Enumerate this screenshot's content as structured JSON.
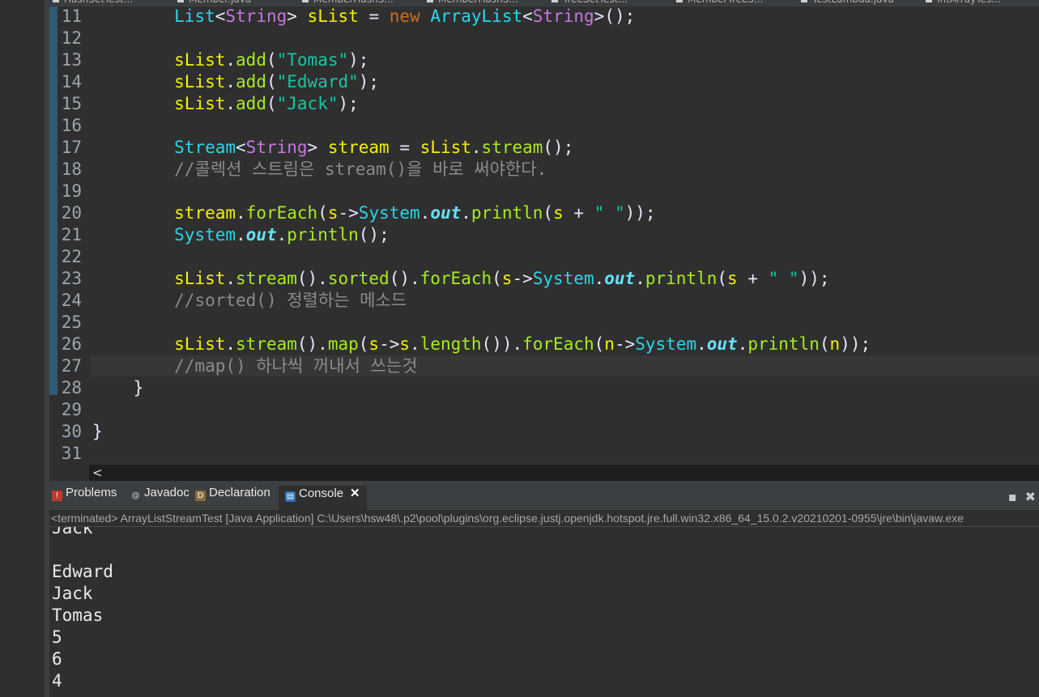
{
  "editor_tabs": [
    "HashSetTest...",
    "Member.java",
    "MemberHashS...",
    "MemberHashS...",
    "TreeSetTest...",
    "MemberTreeS...",
    "TestLambda.java",
    "IntArrayTes..."
  ],
  "code_lines": [
    {
      "n": "11",
      "tokens": [
        [
          "        ",
          ""
        ],
        [
          "List",
          "ty"
        ],
        [
          "<",
          "op"
        ],
        [
          "String",
          "tp"
        ],
        [
          ">",
          "op"
        ],
        [
          " ",
          ""
        ],
        [
          "sList",
          "id"
        ],
        [
          " ",
          ""
        ],
        [
          "=",
          "op"
        ],
        [
          " ",
          ""
        ],
        [
          "new",
          "kw"
        ],
        [
          " ",
          ""
        ],
        [
          "ArrayList",
          "ty"
        ],
        [
          "<",
          "op"
        ],
        [
          "String",
          "tp"
        ],
        [
          ">",
          "op"
        ],
        [
          "();",
          "op"
        ]
      ]
    },
    {
      "n": "12",
      "tokens": []
    },
    {
      "n": "13",
      "tokens": [
        [
          "        ",
          ""
        ],
        [
          "sList",
          "id"
        ],
        [
          ".",
          "op"
        ],
        [
          "add",
          "me"
        ],
        [
          "(",
          "op"
        ],
        [
          "\"Tomas\"",
          "str"
        ],
        [
          ");",
          "op"
        ]
      ]
    },
    {
      "n": "14",
      "tokens": [
        [
          "        ",
          ""
        ],
        [
          "sList",
          "id"
        ],
        [
          ".",
          "op"
        ],
        [
          "add",
          "me"
        ],
        [
          "(",
          "op"
        ],
        [
          "\"Edward\"",
          "str"
        ],
        [
          ");",
          "op"
        ]
      ]
    },
    {
      "n": "15",
      "tokens": [
        [
          "        ",
          ""
        ],
        [
          "sList",
          "id"
        ],
        [
          ".",
          "op"
        ],
        [
          "add",
          "me"
        ],
        [
          "(",
          "op"
        ],
        [
          "\"Jack\"",
          "str"
        ],
        [
          ");",
          "op"
        ]
      ]
    },
    {
      "n": "16",
      "tokens": []
    },
    {
      "n": "17",
      "tokens": [
        [
          "        ",
          ""
        ],
        [
          "Stream",
          "ty"
        ],
        [
          "<",
          "op"
        ],
        [
          "String",
          "tp"
        ],
        [
          ">",
          "op"
        ],
        [
          " ",
          ""
        ],
        [
          "stream",
          "id"
        ],
        [
          " ",
          ""
        ],
        [
          "=",
          "op"
        ],
        [
          " ",
          ""
        ],
        [
          "sList",
          "id"
        ],
        [
          ".",
          "op"
        ],
        [
          "stream",
          "me"
        ],
        [
          "();",
          "op"
        ]
      ]
    },
    {
      "n": "18",
      "tokens": [
        [
          "        ",
          ""
        ],
        [
          "//콜렉션 스트림은 stream()을 바로 써야한다.",
          "cm"
        ]
      ]
    },
    {
      "n": "19",
      "tokens": []
    },
    {
      "n": "20",
      "tokens": [
        [
          "        ",
          ""
        ],
        [
          "stream",
          "id"
        ],
        [
          ".",
          "op"
        ],
        [
          "forEach",
          "me"
        ],
        [
          "(",
          "op"
        ],
        [
          "s",
          "id"
        ],
        [
          "->",
          "op"
        ],
        [
          "System",
          "ty"
        ],
        [
          ".",
          "op"
        ],
        [
          "out",
          "fld"
        ],
        [
          ".",
          "op"
        ],
        [
          "println",
          "me"
        ],
        [
          "(",
          "op"
        ],
        [
          "s",
          "id"
        ],
        [
          " + ",
          "op"
        ],
        [
          "\" \"",
          "str"
        ],
        [
          "));",
          "op"
        ]
      ]
    },
    {
      "n": "21",
      "tokens": [
        [
          "        ",
          ""
        ],
        [
          "System",
          "ty"
        ],
        [
          ".",
          "op"
        ],
        [
          "out",
          "fld"
        ],
        [
          ".",
          "op"
        ],
        [
          "println",
          "me"
        ],
        [
          "();",
          "op"
        ]
      ]
    },
    {
      "n": "22",
      "tokens": []
    },
    {
      "n": "23",
      "tokens": [
        [
          "        ",
          ""
        ],
        [
          "sList",
          "id"
        ],
        [
          ".",
          "op"
        ],
        [
          "stream",
          "me"
        ],
        [
          "().",
          "op"
        ],
        [
          "sorted",
          "me"
        ],
        [
          "().",
          "op"
        ],
        [
          "forEach",
          "me"
        ],
        [
          "(",
          "op"
        ],
        [
          "s",
          "id"
        ],
        [
          "->",
          "op"
        ],
        [
          "System",
          "ty"
        ],
        [
          ".",
          "op"
        ],
        [
          "out",
          "fld"
        ],
        [
          ".",
          "op"
        ],
        [
          "println",
          "me"
        ],
        [
          "(",
          "op"
        ],
        [
          "s",
          "id"
        ],
        [
          " + ",
          "op"
        ],
        [
          "\" \"",
          "str"
        ],
        [
          "));",
          "op"
        ]
      ]
    },
    {
      "n": "24",
      "tokens": [
        [
          "        ",
          ""
        ],
        [
          "//sorted() 정렬하는 메소드",
          "cm"
        ]
      ]
    },
    {
      "n": "25",
      "tokens": []
    },
    {
      "n": "26",
      "tokens": [
        [
          "        ",
          ""
        ],
        [
          "sList",
          "id"
        ],
        [
          ".",
          "op"
        ],
        [
          "stream",
          "me"
        ],
        [
          "().",
          "op"
        ],
        [
          "map",
          "me"
        ],
        [
          "(",
          "op"
        ],
        [
          "s",
          "id"
        ],
        [
          "->",
          "op"
        ],
        [
          "s",
          "id"
        ],
        [
          ".",
          "op"
        ],
        [
          "length",
          "me"
        ],
        [
          "()).",
          "op"
        ],
        [
          "forEach",
          "me"
        ],
        [
          "(",
          "op"
        ],
        [
          "n",
          "id"
        ],
        [
          "->",
          "op"
        ],
        [
          "System",
          "ty"
        ],
        [
          ".",
          "op"
        ],
        [
          "out",
          "fld"
        ],
        [
          ".",
          "op"
        ],
        [
          "println",
          "me"
        ],
        [
          "(",
          "op"
        ],
        [
          "n",
          "id"
        ],
        [
          "));",
          "op"
        ]
      ]
    },
    {
      "n": "27",
      "tokens": [
        [
          "        ",
          ""
        ],
        [
          "//map() 하나씩 꺼내서 쓰는것",
          "cm"
        ]
      ]
    },
    {
      "n": "28",
      "tokens": [
        [
          "    ",
          ""
        ],
        [
          "}",
          "op"
        ]
      ]
    },
    {
      "n": "29",
      "tokens": []
    },
    {
      "n": "30",
      "tokens": [
        [
          "}",
          "op"
        ]
      ]
    },
    {
      "n": "31",
      "tokens": []
    }
  ],
  "scroll_left_arrow": "<",
  "view_tabs": {
    "problems": "Problems",
    "javadoc": "Javadoc",
    "declaration": "Declaration",
    "console": "Console",
    "close": "✕"
  },
  "view_controls": {
    "minimize": "▪",
    "close": "✖"
  },
  "console_status": "<terminated> ArrayListStreamTest [Java Application] C:\\Users\\hsw48\\.p2\\pool\\plugins\\org.eclipse.justj.openjdk.hotspot.jre.full.win32.x86_64_15.0.2.v20210201-0955\\jre\\bin\\javaw.exe",
  "console_output": [
    "Jack",
    "",
    "Edward",
    "Jack",
    "Tomas",
    "5",
    "6",
    "4"
  ]
}
